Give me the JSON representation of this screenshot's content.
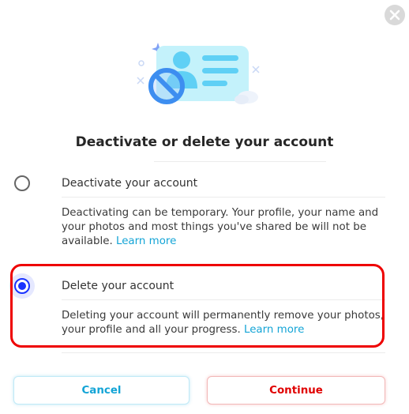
{
  "dialog": {
    "title": "Deactivate or delete your account",
    "close_icon": "close-icon"
  },
  "options": [
    {
      "title": "Deactivate your account",
      "description": "Deactivating can be temporary. Your profile, your name and your photos and most things you've shared be will not be available.",
      "link": "Learn more",
      "selected": false
    },
    {
      "title": "Delete your account",
      "description": "Deleting your account will permanently remove your photos, your profile and all your progress.",
      "link": "Learn more",
      "selected": true
    }
  ],
  "buttons": {
    "cancel": "Cancel",
    "continue": "Continue"
  },
  "colors": {
    "accent": "#13a4d6",
    "selected_radio": "#1a33ff",
    "danger": "#e00000",
    "highlight": "#ee0000"
  }
}
